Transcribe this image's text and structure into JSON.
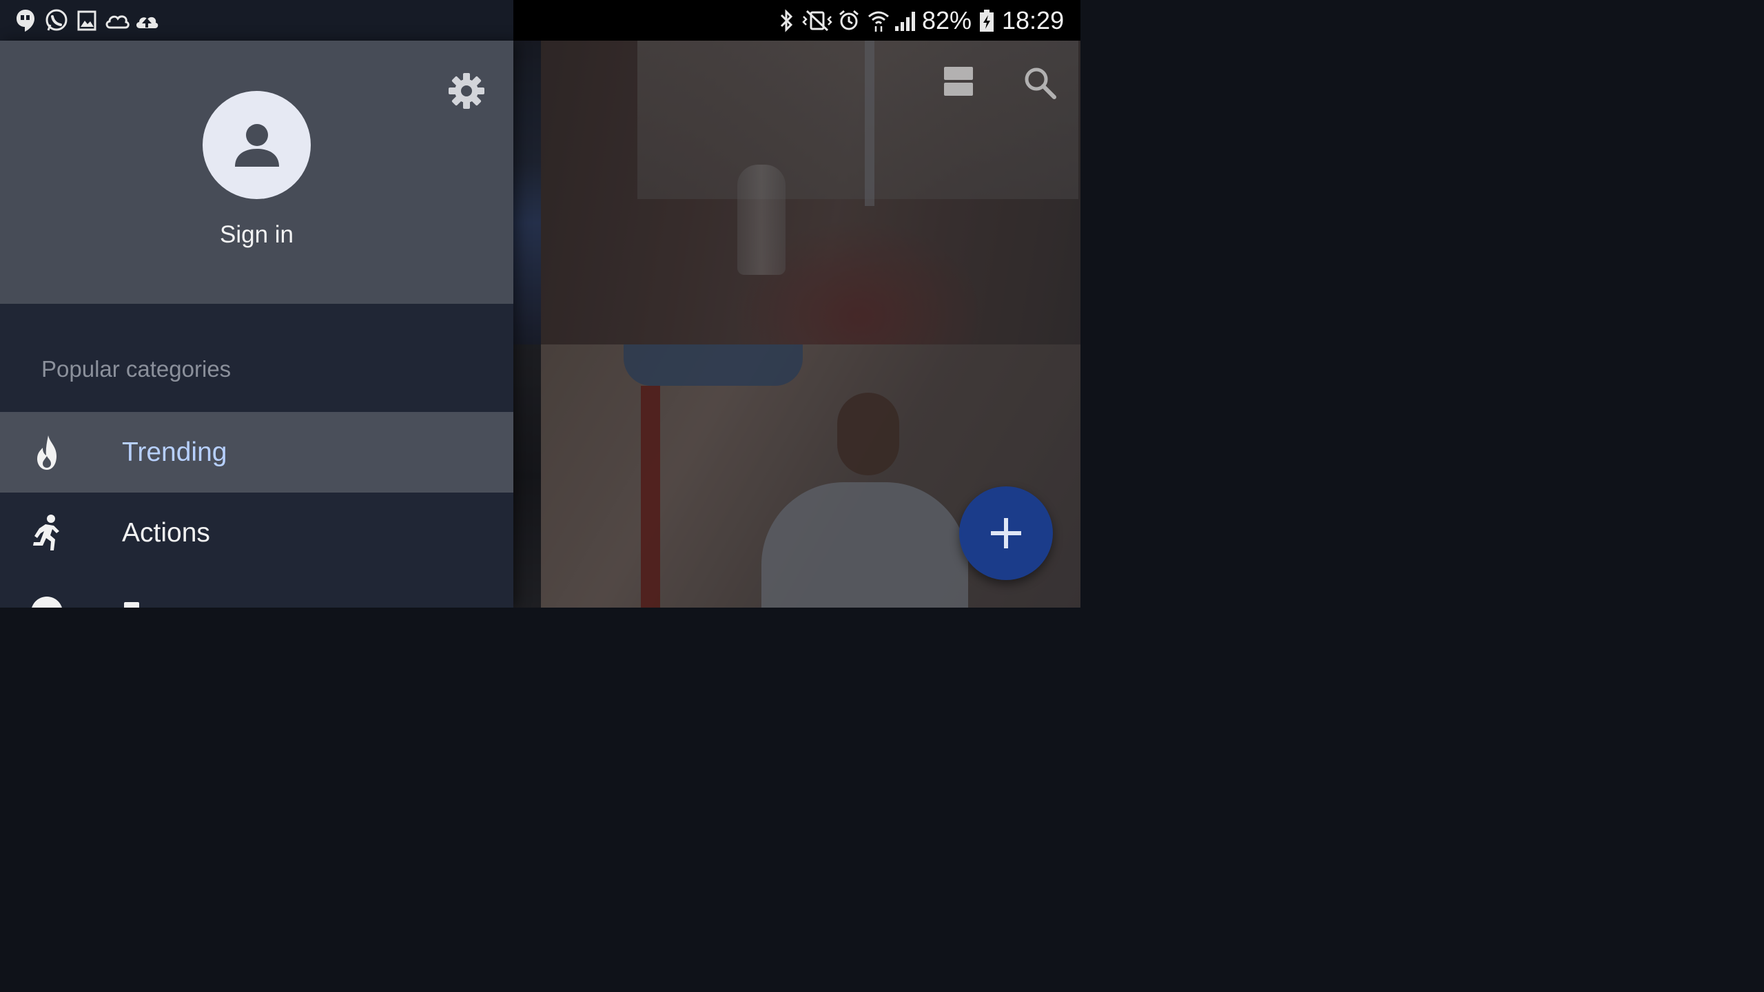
{
  "status_bar": {
    "battery": "82%",
    "time": "18:29",
    "left_icons": [
      "hangouts-icon",
      "whatsapp-icon",
      "gallery-icon",
      "cloud-icon",
      "cloud-upload-icon"
    ],
    "right_icons": [
      "bluetooth-icon",
      "vibrate-icon",
      "alarm-icon",
      "wifi-icon",
      "signal-icon",
      "battery-charging-icon"
    ]
  },
  "drawer": {
    "sign_in_label": "Sign in",
    "section_title": "Popular categories",
    "items": [
      {
        "label": "Trending",
        "icon": "flame-icon",
        "active": true
      },
      {
        "label": "Actions",
        "icon": "running-person-icon",
        "active": false
      }
    ]
  },
  "toolbar": {
    "icons": [
      "view-mode-icon",
      "search-icon"
    ]
  },
  "fab": {
    "icon": "plus-icon"
  },
  "colors": {
    "drawer_bg": "#202635",
    "header_bg": "#474c57",
    "active_item_bg": "#4a4f5a",
    "active_text": "#b7d0ff",
    "fab": "#1b3c8a"
  }
}
